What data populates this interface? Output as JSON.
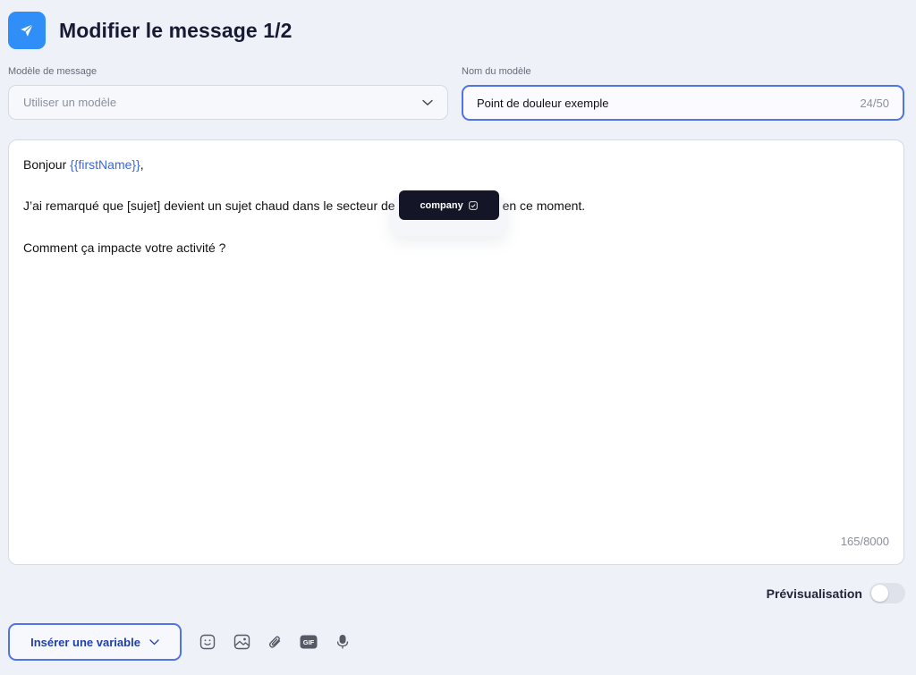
{
  "header": {
    "title": "Modifier le message 1/2",
    "icon": "paper-plane-icon",
    "icon_bg": "#2f8ef7"
  },
  "template_select": {
    "label": "Modèle de message",
    "placeholder": "Utiliser un modèle"
  },
  "template_name": {
    "label": "Nom du modèle",
    "value": "Point de douleur exemple",
    "count": "24/50"
  },
  "editor": {
    "greeting": "Bonjour ",
    "first_name_var": "{{firstName}}",
    "greeting_end": ",",
    "line2_before": "J’ai remarqué que [sujet] devient un sujet chaud dans le secteur de",
    "company_chip": "company",
    "line2_after": "en ce moment.",
    "line3": "Comment ça impacte votre activité ?",
    "char_count": "165/8000"
  },
  "preview": {
    "label": "Prévisualisation",
    "enabled": false
  },
  "toolbar": {
    "insert_variable_label": "Insérer une variable",
    "icons": [
      "emoji-icon",
      "image-icon",
      "attachment-icon",
      "gif-icon",
      "microphone-icon"
    ]
  },
  "colors": {
    "accent": "#4f74e6",
    "variable": "#3c66e0",
    "background": "#eff1f9",
    "chip": "#141627"
  }
}
